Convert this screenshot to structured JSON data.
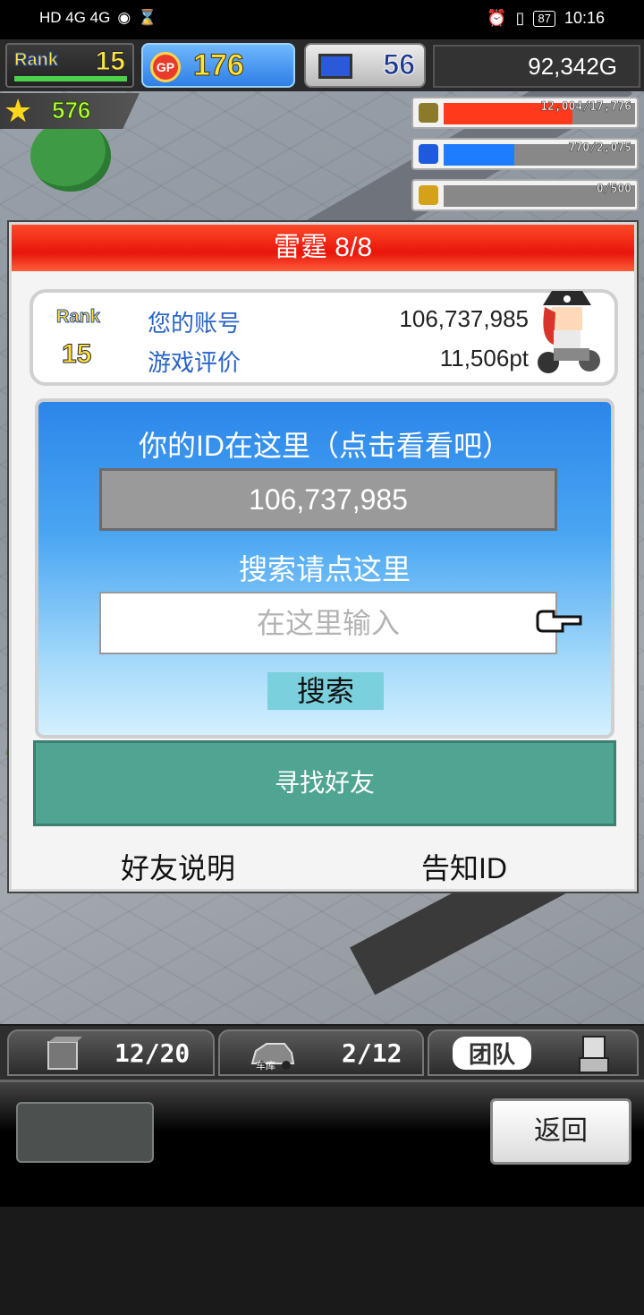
{
  "status_bar": {
    "left_icons": "HD 4G 4G",
    "battery": "87",
    "time": "10:16"
  },
  "hud": {
    "rank_label": "Rank",
    "rank_value": "15",
    "gp_label": "GP",
    "gp_value": "176",
    "pc_value": "56",
    "money": "92,342G",
    "star_value": "576"
  },
  "resources": [
    {
      "icon": "coin-stack-icon",
      "text": "12,004/17,776",
      "fill": 0.675,
      "color": "#ff3a1c"
    },
    {
      "icon": "fuel-bottle-icon",
      "text": "770/2,075",
      "fill": 0.371,
      "color": "#1e7cff"
    },
    {
      "icon": "wheat-icon",
      "text": "0/500",
      "fill": 0.0,
      "color": "#e0b010"
    }
  ],
  "dialog": {
    "title": "雷霆 8/8",
    "rank_label": "Rank",
    "rank_value": "15",
    "account_label": "您的账号",
    "account_value": "106,737,985",
    "rating_label": "游戏评价",
    "rating_value": "11,506pt",
    "id_heading": "你的ID在这里（点击看看吧）",
    "id_value": "106,737,985",
    "search_heading": "搜索请点这里",
    "search_placeholder": "在这里输入",
    "search_button": "搜索",
    "find_friend": "寻找好友",
    "friend_help": "好友说明",
    "share_id": "告知ID"
  },
  "tabs": {
    "slot_count": "12/20",
    "garage_label": "车库",
    "garage_count": "2/12",
    "team_label": "团队"
  },
  "footer": {
    "back_button": "返回"
  }
}
